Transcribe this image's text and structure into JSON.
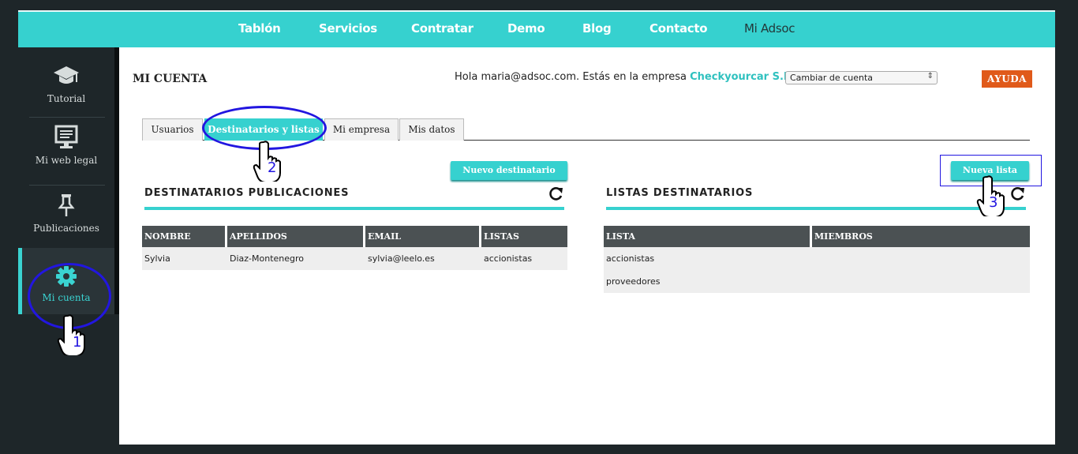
{
  "topnav": {
    "items": [
      "Tablón",
      "Servicios",
      "Contratar",
      "Demo",
      "Blog",
      "Contacto",
      "Mi Adsoc"
    ]
  },
  "sidebar": {
    "items": [
      {
        "label": "Tutorial",
        "icon": "graduation-cap-icon"
      },
      {
        "label": "Mi web legal",
        "icon": "monitor-icon"
      },
      {
        "label": "Publicaciones",
        "icon": "pushpin-icon"
      },
      {
        "label": "Mi cuenta",
        "icon": "gear-icon",
        "active": true
      }
    ]
  },
  "header": {
    "title": "MI CUENTA",
    "greeting_prefix": "Hola maria@adsoc.com. Estás en la empresa",
    "company": "Checkyourcar S.L.",
    "account_select": "Cambiar de cuenta",
    "help_label": "AYUDA"
  },
  "tabs": [
    {
      "label": "Usuarios"
    },
    {
      "label": "Destinatarios y listas",
      "active": true
    },
    {
      "label": "Mi empresa"
    },
    {
      "label": "Mis datos"
    }
  ],
  "left_panel": {
    "new_button": "Nuevo destinatario",
    "title": "DESTINATARIOS PUBLICACIONES",
    "columns": [
      "NOMBRE",
      "APELLIDOS",
      "EMAIL",
      "LISTAS"
    ],
    "rows": [
      [
        "Sylvia",
        "Diaz-Montenegro",
        "sylvia@leelo.es",
        "accionistas"
      ]
    ]
  },
  "right_panel": {
    "new_button": "Nueva lista",
    "title": "LISTAS DESTINATARIOS",
    "columns": [
      "LISTA",
      "MIEMBROS"
    ],
    "rows": [
      [
        "accionistas",
        ""
      ],
      [
        "proveedores",
        ""
      ]
    ]
  },
  "annotations": {
    "step1": "1",
    "step2": "2",
    "step3": "3"
  },
  "colors": {
    "accent": "#36d1cf",
    "help": "#e05a1a",
    "annotation": "#2216e0",
    "sidebar": "#1e2629"
  }
}
